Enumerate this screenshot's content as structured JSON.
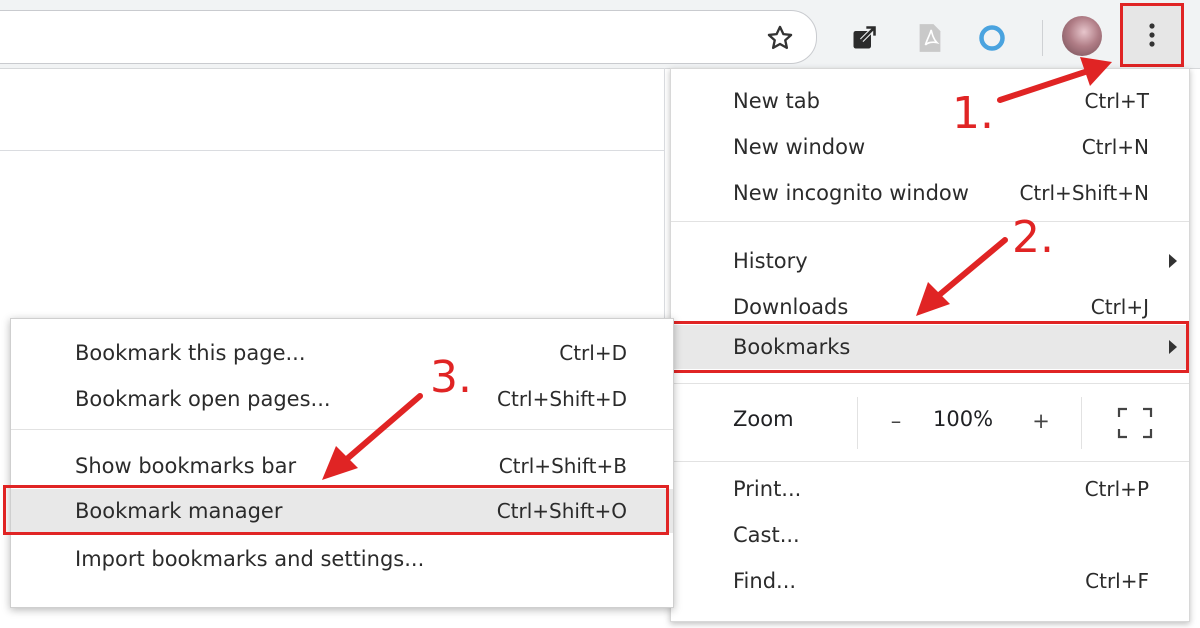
{
  "toolbar": {
    "icons": [
      "star-icon",
      "share-icon",
      "pdf-icon",
      "extension-ring-icon",
      "profile-avatar",
      "more-menu-icon"
    ]
  },
  "main_menu": {
    "items": [
      {
        "label": "New tab",
        "shortcut": "Ctrl+T"
      },
      {
        "label": "New window",
        "shortcut": "Ctrl+N"
      },
      {
        "label": "New incognito window",
        "shortcut": "Ctrl+Shift+N"
      },
      {
        "label": "History",
        "shortcut": ""
      },
      {
        "label": "Downloads",
        "shortcut": "Ctrl+J"
      },
      {
        "label": "Bookmarks",
        "shortcut": ""
      },
      {
        "label": "Print...",
        "shortcut": "Ctrl+P"
      },
      {
        "label": "Cast...",
        "shortcut": ""
      },
      {
        "label": "Find...",
        "shortcut": "Ctrl+F"
      }
    ],
    "zoom": {
      "label": "Zoom",
      "minus": "–",
      "value": "100%",
      "plus": "+"
    }
  },
  "bookmarks_submenu": {
    "items": [
      {
        "label": "Bookmark this page...",
        "shortcut": "Ctrl+D"
      },
      {
        "label": "Bookmark open pages...",
        "shortcut": "Ctrl+Shift+D"
      },
      {
        "label": "Show bookmarks bar",
        "shortcut": "Ctrl+Shift+B"
      },
      {
        "label": "Bookmark manager",
        "shortcut": "Ctrl+Shift+O"
      },
      {
        "label": "Import bookmarks and settings...",
        "shortcut": ""
      }
    ]
  },
  "annotations": {
    "step1": "1.",
    "step2": "2.",
    "step3": "3.",
    "highlight_color": "#e02424"
  }
}
